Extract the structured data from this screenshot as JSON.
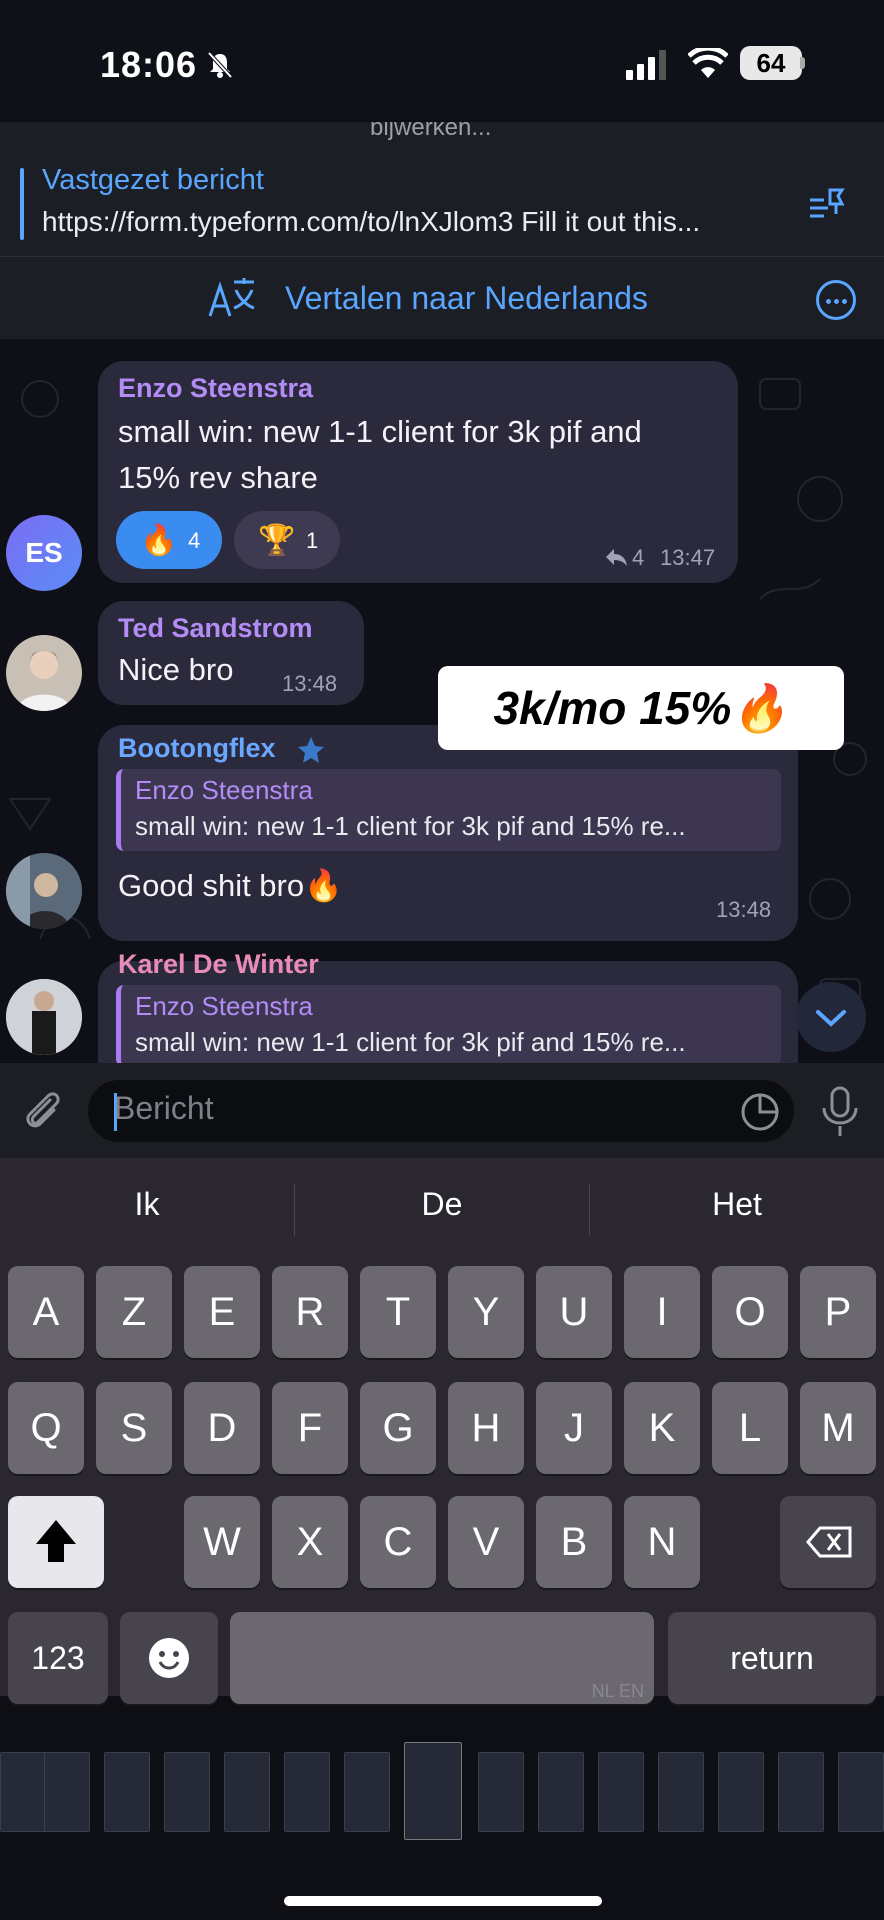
{
  "status_bar": {
    "time": "18:06",
    "battery": "64"
  },
  "header": {
    "top_text": "bijwerken...",
    "pinned_title": "Vastgezet bericht",
    "pinned_text": "https://form.typeform.com/to/lnXJlom3 Fill it out this...",
    "translate_label": "Vertalen naar Nederlands"
  },
  "messages": [
    {
      "sender": "Enzo Steenstra",
      "text_line1": "small win: new 1-1 client for 3k pif and",
      "text_line2": "15% rev share",
      "reactions": [
        {
          "emoji": "🔥",
          "count": "4"
        },
        {
          "emoji": "🏆",
          "count": "1"
        }
      ],
      "replies": "4",
      "time": "13:47",
      "avatar_initials": "ES"
    },
    {
      "sender": "Ted Sandstrom",
      "text": "Nice bro",
      "time": "13:48"
    },
    {
      "sender": "Bootongflex",
      "reply_name": "Enzo Steenstra",
      "reply_text": "small win: new 1-1 client for 3k pif and 15% re...",
      "text": "Good shit bro🔥",
      "time": "13:48"
    },
    {
      "sender": "Karel De Winter",
      "reply_name": "Enzo Steenstra",
      "reply_text": "small win: new 1-1 client for 3k pif and 15% re..."
    }
  ],
  "overlay_text": "3k/mo 15%🔥",
  "composer": {
    "placeholder": "Bericht"
  },
  "keyboard": {
    "suggestions": [
      "Ik",
      "De",
      "Het"
    ],
    "row1": [
      "A",
      "Z",
      "E",
      "R",
      "T",
      "Y",
      "U",
      "I",
      "O",
      "P"
    ],
    "row2": [
      "Q",
      "S",
      "D",
      "F",
      "G",
      "H",
      "J",
      "K",
      "L",
      "M"
    ],
    "row3": [
      "W",
      "X",
      "C",
      "V",
      "B",
      "N"
    ],
    "numbers_label": "123",
    "return_label": "return",
    "lang_label": "NL EN"
  },
  "colors": {
    "accent": "#5aa6ff",
    "bubble": "#2b2a3d",
    "name_purple": "#b48cf5",
    "name_pink": "#e88bb8"
  }
}
